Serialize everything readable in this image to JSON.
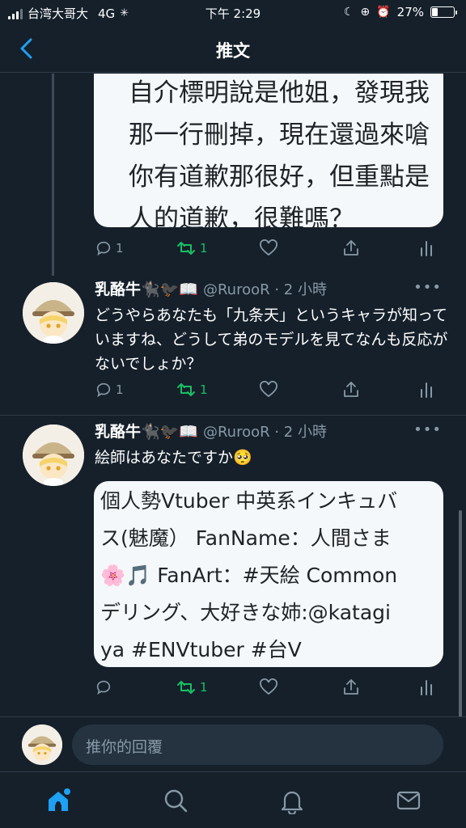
{
  "status_bar": {
    "carrier": "台湾大哥大",
    "network": "4G",
    "time": "下午 2:29",
    "battery": "27%",
    "battery_level": 0.27
  },
  "nav": {
    "title": "推文",
    "back_icon": "chevron-left-icon"
  },
  "previous_tweet": {
    "card_lines": [
      "自介標明說是他姐，發現我",
      "那一行刪掉，現在還過來嗆",
      "你有道歉那很好，但重點是",
      "人的道歉，很難嗎？"
    ],
    "reply_count": "1",
    "retweet_count": "1"
  },
  "tweets": [
    {
      "display_name": "乳酪牛🐈‍⬛🐦‍⬛📖",
      "handle_time": "@RurooR · 2 小時",
      "text": "どうやらあなたも「九条天」というキャラが知っていますね、どうして弟のモデルを見てなんも反応がないでしょか？",
      "reply_count": "1",
      "retweet_count": "1"
    },
    {
      "display_name": "乳酪牛🐈‍⬛🐦‍⬛📖",
      "handle_time": "@RurooR · 2 小時",
      "text": "絵師はあなたですか🥺",
      "card_lines": [
        "個人勢Vtuber 中英系インキュバ",
        "ス(魅魔） FanName：人間さま",
        "🌸🎵 FanArt：#天絵 Common",
        "デリング、大好きな姉:@katagi",
        "ya #ENVtuber #台V"
      ],
      "reply_count": "",
      "retweet_count": "1"
    }
  ],
  "more_icon": "•••",
  "reply_bar": {
    "placeholder": "推你的回覆"
  },
  "tab_bar": {
    "items": [
      "home-icon",
      "search-icon",
      "notifications-icon",
      "messages-icon"
    ],
    "active": "home-icon"
  },
  "colors": {
    "background": "#15202b",
    "accent": "#1da1f2",
    "retweet": "#17bf63",
    "muted": "#8899a6",
    "link": "#1b4f94"
  }
}
